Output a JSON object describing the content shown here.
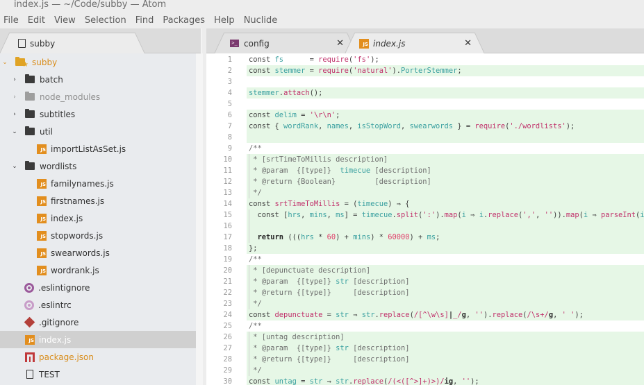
{
  "window": {
    "title": "index.js — ~/Code/subby — Atom"
  },
  "menu": [
    "File",
    "Edit",
    "View",
    "Selection",
    "Find",
    "Packages",
    "Help",
    "Nuclide"
  ],
  "sidebar": {
    "tab_label": "subby",
    "tree": [
      {
        "label": "subby",
        "type": "root-folder",
        "expanded": true
      },
      {
        "label": "batch",
        "type": "folder",
        "expanded": false
      },
      {
        "label": "node_modules",
        "type": "folder",
        "expanded": false,
        "dimmed": true
      },
      {
        "label": "subtitles",
        "type": "folder",
        "expanded": false
      },
      {
        "label": "util",
        "type": "folder",
        "expanded": true
      },
      {
        "label": "importListAsSet.js",
        "type": "js-file"
      },
      {
        "label": "wordlists",
        "type": "folder",
        "expanded": true
      },
      {
        "label": "familynames.js",
        "type": "js-file"
      },
      {
        "label": "firstnames.js",
        "type": "js-file"
      },
      {
        "label": "index.js",
        "type": "js-file"
      },
      {
        "label": "stopwords.js",
        "type": "js-file"
      },
      {
        "label": "swearwords.js",
        "type": "js-file"
      },
      {
        "label": "wordrank.js",
        "type": "js-file"
      },
      {
        "label": ".eslintignore",
        "type": "eslint-file"
      },
      {
        "label": ".eslintrc",
        "type": "eslint-file"
      },
      {
        "label": ".gitignore",
        "type": "git-file"
      },
      {
        "label": "index.js",
        "type": "js-file",
        "selected": true
      },
      {
        "label": "package.json",
        "type": "npm-file",
        "modified": true
      },
      {
        "label": "TEST",
        "type": "plain-file"
      }
    ]
  },
  "tabs": [
    {
      "label": "config",
      "icon": "terminal-icon",
      "active": false
    },
    {
      "label": "index.js",
      "icon": "js-icon",
      "active": true
    }
  ],
  "editor": {
    "lines": [
      {
        "n": "1",
        "hl": false
      },
      {
        "n": "2",
        "hl": true
      },
      {
        "n": "3",
        "hl": false
      },
      {
        "n": "4",
        "hl": true
      },
      {
        "n": "5",
        "hl": false
      },
      {
        "n": "6",
        "hl": true
      },
      {
        "n": "7",
        "hl": true
      },
      {
        "n": "8",
        "hl": true
      },
      {
        "n": "9",
        "hl": false
      },
      {
        "n": "10",
        "hl": true
      },
      {
        "n": "11",
        "hl": true
      },
      {
        "n": "12",
        "hl": true
      },
      {
        "n": "13",
        "hl": true
      },
      {
        "n": "14",
        "hl": true
      },
      {
        "n": "15",
        "hl": true
      },
      {
        "n": "16",
        "hl": true
      },
      {
        "n": "17",
        "hl": true
      },
      {
        "n": "18",
        "hl": true
      },
      {
        "n": "19",
        "hl": false
      },
      {
        "n": "20",
        "hl": true
      },
      {
        "n": "21",
        "hl": true
      },
      {
        "n": "22",
        "hl": true
      },
      {
        "n": "23",
        "hl": true
      },
      {
        "n": "24",
        "hl": true
      },
      {
        "n": "25",
        "hl": false
      },
      {
        "n": "26",
        "hl": true
      },
      {
        "n": "27",
        "hl": true
      },
      {
        "n": "28",
        "hl": true
      },
      {
        "n": "29",
        "hl": true
      },
      {
        "n": "30",
        "hl": true
      }
    ],
    "tokens": [
      [
        [
          "kw",
          "const "
        ],
        [
          "var",
          "fs"
        ],
        [
          "kw",
          "      = "
        ],
        [
          "fn",
          "require"
        ],
        [
          "kw",
          "("
        ],
        [
          "str",
          "'fs'"
        ],
        [
          "kw",
          ");"
        ]
      ],
      [
        [
          "kw",
          "const "
        ],
        [
          "var",
          "stemmer"
        ],
        [
          "kw",
          " = "
        ],
        [
          "fn",
          "require"
        ],
        [
          "kw",
          "("
        ],
        [
          "str",
          "'natural'"
        ],
        [
          "kw",
          ")."
        ],
        [
          "var",
          "PorterStemmer"
        ],
        [
          "kw",
          ";"
        ]
      ],
      [],
      [
        [
          "var",
          "stemmer"
        ],
        [
          "kw",
          "."
        ],
        [
          "fn",
          "attach"
        ],
        [
          "kw",
          "();"
        ]
      ],
      [],
      [
        [
          "kw",
          "const "
        ],
        [
          "var",
          "delim"
        ],
        [
          "kw",
          " = "
        ],
        [
          "str",
          "'\\r\\n'"
        ],
        [
          "kw",
          ";"
        ]
      ],
      [
        [
          "kw",
          "const { "
        ],
        [
          "var",
          "wordRank"
        ],
        [
          "kw",
          ", "
        ],
        [
          "var",
          "names"
        ],
        [
          "kw",
          ", "
        ],
        [
          "var",
          "isStopWord"
        ],
        [
          "kw",
          ", "
        ],
        [
          "var",
          "swearwords"
        ],
        [
          "kw",
          " } = "
        ],
        [
          "fn",
          "require"
        ],
        [
          "kw",
          "("
        ],
        [
          "str",
          "'./wordlists'"
        ],
        [
          "kw",
          ");"
        ]
      ],
      [],
      [
        [
          "cm",
          "/**"
        ]
      ],
      [
        [
          "cm",
          " * [srtTimeToMillis description]"
        ]
      ],
      [
        [
          "cm",
          " * @param  {[type]}  "
        ],
        [
          "var",
          "timecue"
        ],
        [
          "cm",
          " [description]"
        ]
      ],
      [
        [
          "cm",
          " * @return {Boolean}         [description]"
        ]
      ],
      [
        [
          "cm",
          " */"
        ]
      ],
      [
        [
          "kw",
          "const "
        ],
        [
          "fn",
          "srtTimeToMillis"
        ],
        [
          "kw",
          " = ("
        ],
        [
          "var",
          "timecue"
        ],
        [
          "kw",
          ") ⇒ {"
        ]
      ],
      [
        [
          "kw",
          "  const ["
        ],
        [
          "var",
          "hrs"
        ],
        [
          "kw",
          ", "
        ],
        [
          "var",
          "mins"
        ],
        [
          "kw",
          ", "
        ],
        [
          "var",
          "ms"
        ],
        [
          "kw",
          "] = "
        ],
        [
          "var",
          "timecue"
        ],
        [
          "kw",
          "."
        ],
        [
          "fn",
          "split"
        ],
        [
          "kw",
          "("
        ],
        [
          "str",
          "':'"
        ],
        [
          "kw",
          ")."
        ],
        [
          "fn",
          "map"
        ],
        [
          "kw",
          "("
        ],
        [
          "var",
          "i"
        ],
        [
          "kw",
          " ⇒ "
        ],
        [
          "var",
          "i"
        ],
        [
          "kw",
          "."
        ],
        [
          "fn",
          "replace"
        ],
        [
          "kw",
          "("
        ],
        [
          "str",
          "','"
        ],
        [
          "kw",
          ", "
        ],
        [
          "str",
          "''"
        ],
        [
          "kw",
          "))."
        ],
        [
          "fn",
          "map"
        ],
        [
          "kw",
          "("
        ],
        [
          "var",
          "i"
        ],
        [
          "kw",
          " ⇒ "
        ],
        [
          "fn",
          "parseInt"
        ],
        [
          "kw",
          "("
        ],
        [
          "var",
          "i"
        ],
        [
          "kw",
          ", "
        ]
      ],
      [],
      [
        [
          "kw",
          "  "
        ],
        [
          "kwb",
          "return"
        ],
        [
          "kw",
          " ((("
        ],
        [
          "var",
          "hrs"
        ],
        [
          "kw",
          " * "
        ],
        [
          "num",
          "60"
        ],
        [
          "kw",
          ") + "
        ],
        [
          "var",
          "mins"
        ],
        [
          "kw",
          ") * "
        ],
        [
          "num",
          "60000"
        ],
        [
          "kw",
          ") + "
        ],
        [
          "var",
          "ms"
        ],
        [
          "kw",
          ";"
        ]
      ],
      [
        [
          "kw",
          "};"
        ]
      ],
      [
        [
          "cm",
          "/**"
        ]
      ],
      [
        [
          "cm",
          " * [depunctuate description]"
        ]
      ],
      [
        [
          "cm",
          " * @param  {[type]} "
        ],
        [
          "var",
          "str"
        ],
        [
          "cm",
          " [description]"
        ]
      ],
      [
        [
          "cm",
          " * @return {[type]}     [description]"
        ]
      ],
      [
        [
          "cm",
          " */"
        ]
      ],
      [
        [
          "kw",
          "const "
        ],
        [
          "fn",
          "depunctuate"
        ],
        [
          "kw",
          " = "
        ],
        [
          "var",
          "str"
        ],
        [
          "kw",
          " ⇒ "
        ],
        [
          "var",
          "str"
        ],
        [
          "kw",
          "."
        ],
        [
          "fn",
          "replace"
        ],
        [
          "kw",
          "("
        ],
        [
          "str",
          "/[^\\w\\s]"
        ],
        [
          "kwb",
          "|"
        ],
        [
          "str",
          "_/"
        ],
        [
          "kwb",
          "g"
        ],
        [
          "kw",
          ", "
        ],
        [
          "str",
          "''"
        ],
        [
          "kw",
          ")."
        ],
        [
          "fn",
          "replace"
        ],
        [
          "kw",
          "("
        ],
        [
          "str",
          "/\\s+/"
        ],
        [
          "kwb",
          "g"
        ],
        [
          "kw",
          ", "
        ],
        [
          "str",
          "' '"
        ],
        [
          "kw",
          ");"
        ]
      ],
      [
        [
          "cm",
          "/**"
        ]
      ],
      [
        [
          "cm",
          " * [untag description]"
        ]
      ],
      [
        [
          "cm",
          " * @param  {[type]} "
        ],
        [
          "var",
          "str"
        ],
        [
          "cm",
          " [description]"
        ]
      ],
      [
        [
          "cm",
          " * @return {[type]}     [description]"
        ]
      ],
      [
        [
          "cm",
          " */"
        ]
      ],
      [
        [
          "kw",
          "const "
        ],
        [
          "var",
          "untag"
        ],
        [
          "kw",
          " = "
        ],
        [
          "var",
          "str"
        ],
        [
          "kw",
          " ⇒ "
        ],
        [
          "var",
          "str"
        ],
        [
          "kw",
          "."
        ],
        [
          "fn",
          "replace"
        ],
        [
          "kw",
          "("
        ],
        [
          "str",
          "/(<([^>]+)>)/"
        ],
        [
          "kwb",
          "ig"
        ],
        [
          "kw",
          ", "
        ],
        [
          "str",
          "''"
        ],
        [
          "kw",
          ");"
        ]
      ]
    ]
  },
  "colors": {
    "accent_orange": "#e28e1e",
    "line_highlight": "#e6f7e6",
    "variable": "#3aa0a0",
    "function_string": "#c0306a"
  }
}
